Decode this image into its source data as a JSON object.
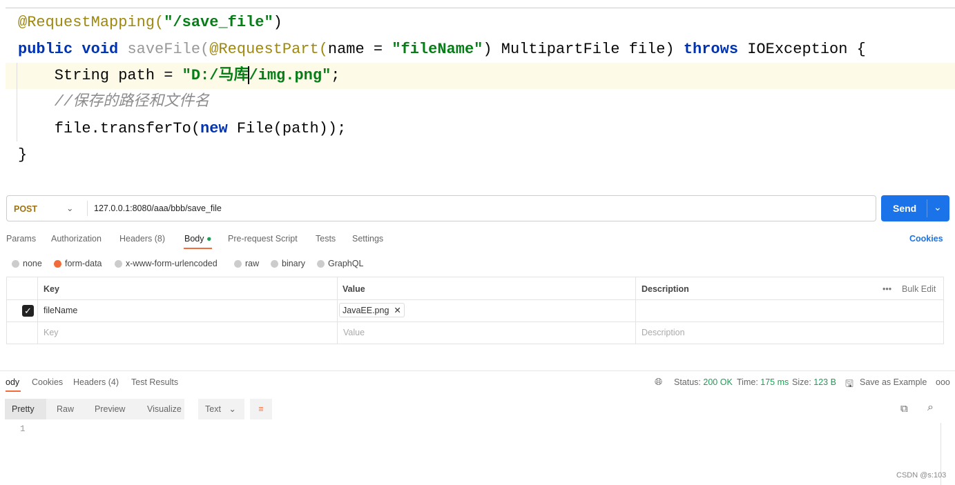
{
  "code": {
    "line1": {
      "ann": "@RequestMapping(",
      "str": "\"/save_file\"",
      "end": ")"
    },
    "line2": {
      "kw1": "public void ",
      "fn": "saveFile(",
      "ann": "@RequestPart(",
      "mid": "name = ",
      "str": "\"fileName\"",
      "mid2": ") MultipartFile file) ",
      "kw2": "throws",
      "end": " IOException {"
    },
    "line3": {
      "pre": "    String path = ",
      "str1": "\"D:/马库",
      "str2": "/img.png\"",
      "end": ";"
    },
    "line4": "    //保存的路径和文件名",
    "line5": {
      "pre": "    file.transferTo(",
      "kw": "new",
      "end": " File(path));"
    },
    "line6": "}"
  },
  "request": {
    "method": "POST",
    "url": "127.0.0.1:8080/aaa/bbb/save_file",
    "send": "Send"
  },
  "tabs": [
    "Params",
    "Authorization",
    "Headers (8)",
    "Body",
    "Pre-request Script",
    "Tests",
    "Settings"
  ],
  "cookies": "Cookies",
  "body_types": [
    "none",
    "form-data",
    "x-www-form-urlencoded",
    "raw",
    "binary",
    "GraphQL"
  ],
  "selected_body_type": "form-data",
  "table": {
    "headers": [
      "Key",
      "Value",
      "Description"
    ],
    "bulk_edit": "Bulk Edit",
    "rows": [
      {
        "checked": true,
        "key": "fileName",
        "value": "JavaEE.png"
      }
    ],
    "placeholder": {
      "key": "Key",
      "value": "Value",
      "description": "Description"
    }
  },
  "response": {
    "tabs": [
      "ody",
      "Cookies",
      "Headers (4)",
      "Test Results"
    ],
    "status_label": "Status:",
    "status": "200 OK",
    "time_label": "Time:",
    "time": "175 ms",
    "size_label": "Size:",
    "size": "123 B",
    "save_example": "Save as Example",
    "views": [
      "Pretty",
      "Raw",
      "Preview",
      "Visualize"
    ],
    "format": "Text",
    "line_no": "1"
  },
  "watermark": "CSDN @s:103",
  "colors": {
    "accent": "#f26b3a",
    "send": "#1a73e8",
    "status_green": "#1f9d55"
  }
}
